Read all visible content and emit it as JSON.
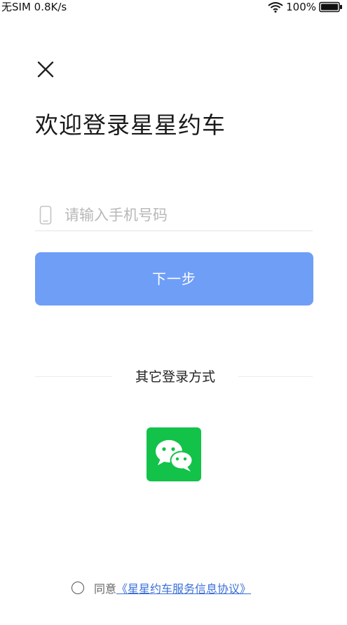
{
  "status_bar": {
    "carrier": "无SIM",
    "speed": "0.8K/s",
    "battery": "100%",
    "wifi_icon": "wifi-icon",
    "battery_icon": "battery-icon"
  },
  "header": {
    "close_icon": "close-icon"
  },
  "title": "欢迎登录星星约车",
  "phone_input": {
    "placeholder": "请输入手机号码",
    "value": "",
    "icon": "phone-icon"
  },
  "next_button": {
    "label": "下一步"
  },
  "other_login": {
    "label": "其它登录方式",
    "wechat_icon": "wechat-icon"
  },
  "agreement": {
    "prefix": "同意",
    "link": "《星星约车服务信息协议》"
  },
  "colors": {
    "primary_button": "#6f9ef7",
    "wechat": "#12c249",
    "link": "#3b6fd8"
  }
}
